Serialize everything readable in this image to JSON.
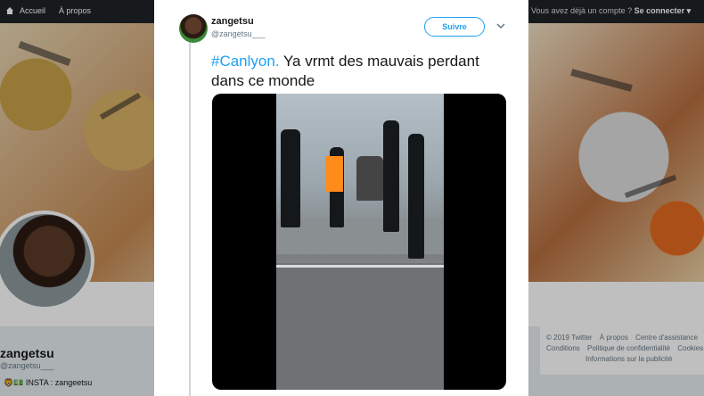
{
  "topnav": {
    "home_label": "Accueil",
    "about_label": "À propos",
    "account_prompt": "Vous avez déjà un compte ?",
    "login_label": "Se connecter"
  },
  "profile": {
    "name": "zangetsu",
    "handle": "@zangetsu___",
    "bio": "🦁💵 INSTA : zangeetsu"
  },
  "tweet": {
    "name": "zangetsu",
    "handle": "@zangetsu___",
    "follow_label": "Suivre",
    "hashtag": "#Canlyon.",
    "text": " Ya vrmt des mauvais perdant dans ce monde"
  },
  "footer": {
    "items": [
      "© 2019 Twitter",
      "À propos",
      "Centre d'assistance",
      "Conditions",
      "Politique de confidentialité",
      "Cookies",
      "Informations sur la publicité"
    ]
  },
  "colors": {
    "accent": "#1da1f2",
    "nav_bg": "#1f2326"
  },
  "icons": {
    "home": "home-icon",
    "chevron": "chevron-down-icon"
  }
}
